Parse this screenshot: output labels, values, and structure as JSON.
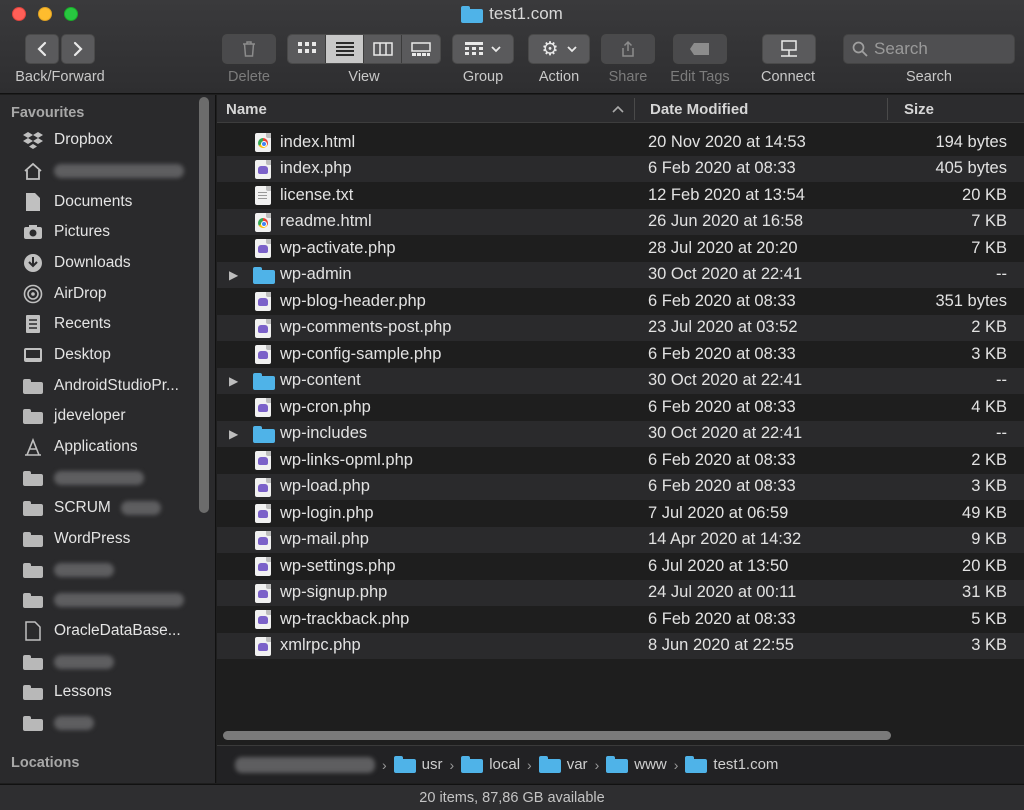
{
  "window": {
    "title": "test1.com"
  },
  "toolbar": {
    "back_forward_label": "Back/Forward",
    "delete_label": "Delete",
    "view_label": "View",
    "group_label": "Group",
    "action_label": "Action",
    "share_label": "Share",
    "edit_tags_label": "Edit Tags",
    "connect_label": "Connect",
    "search_label": "Search",
    "search_placeholder": "Search"
  },
  "sidebar": {
    "favourites_header": "Favourites",
    "locations_header": "Locations",
    "items": [
      {
        "label": "Dropbox",
        "icon": "dropbox-icon"
      },
      {
        "label": "",
        "icon": "home-icon",
        "redacted": true
      },
      {
        "label": "Documents",
        "icon": "document-icon"
      },
      {
        "label": "Pictures",
        "icon": "camera-icon"
      },
      {
        "label": "Downloads",
        "icon": "download-icon"
      },
      {
        "label": "AirDrop",
        "icon": "airdrop-icon"
      },
      {
        "label": "Recents",
        "icon": "recents-icon"
      },
      {
        "label": "Desktop",
        "icon": "desktop-icon"
      },
      {
        "label": "AndroidStudioPr...",
        "icon": "folder-icon"
      },
      {
        "label": "jdeveloper",
        "icon": "folder-icon"
      },
      {
        "label": "Applications",
        "icon": "applications-icon"
      },
      {
        "label": "",
        "icon": "folder-icon",
        "redacted": true
      },
      {
        "label": "SCRUM",
        "icon": "folder-icon"
      },
      {
        "label": "WordPress",
        "icon": "folder-icon"
      },
      {
        "label": "",
        "icon": "folder-icon",
        "redacted": true
      },
      {
        "label": "",
        "icon": "folder-icon",
        "redacted": true
      },
      {
        "label": "OracleDataBase...",
        "icon": "document-icon"
      },
      {
        "label": "",
        "icon": "folder-icon",
        "redacted": true
      },
      {
        "label": "Lessons",
        "icon": "folder-icon"
      },
      {
        "label": "",
        "icon": "folder-icon",
        "redacted": true
      }
    ]
  },
  "columns": {
    "name": "Name",
    "date": "Date Modified",
    "size": "Size"
  },
  "files": [
    {
      "name": "index.html",
      "date": "20 Nov 2020 at 14:53",
      "size": "194 bytes",
      "type": "html"
    },
    {
      "name": "index.php",
      "date": "6 Feb 2020 at 08:33",
      "size": "405 bytes",
      "type": "php"
    },
    {
      "name": "license.txt",
      "date": "12 Feb 2020 at 13:54",
      "size": "20 KB",
      "type": "txt"
    },
    {
      "name": "readme.html",
      "date": "26 Jun 2020 at 16:58",
      "size": "7 KB",
      "type": "html"
    },
    {
      "name": "wp-activate.php",
      "date": "28 Jul 2020 at 20:20",
      "size": "7 KB",
      "type": "php"
    },
    {
      "name": "wp-admin",
      "date": "30 Oct 2020 at 22:41",
      "size": "--",
      "type": "folder"
    },
    {
      "name": "wp-blog-header.php",
      "date": "6 Feb 2020 at 08:33",
      "size": "351 bytes",
      "type": "php"
    },
    {
      "name": "wp-comments-post.php",
      "date": "23 Jul 2020 at 03:52",
      "size": "2 KB",
      "type": "php"
    },
    {
      "name": "wp-config-sample.php",
      "date": "6 Feb 2020 at 08:33",
      "size": "3 KB",
      "type": "php"
    },
    {
      "name": "wp-content",
      "date": "30 Oct 2020 at 22:41",
      "size": "--",
      "type": "folder"
    },
    {
      "name": "wp-cron.php",
      "date": "6 Feb 2020 at 08:33",
      "size": "4 KB",
      "type": "php"
    },
    {
      "name": "wp-includes",
      "date": "30 Oct 2020 at 22:41",
      "size": "--",
      "type": "folder"
    },
    {
      "name": "wp-links-opml.php",
      "date": "6 Feb 2020 at 08:33",
      "size": "2 KB",
      "type": "php"
    },
    {
      "name": "wp-load.php",
      "date": "6 Feb 2020 at 08:33",
      "size": "3 KB",
      "type": "php"
    },
    {
      "name": "wp-login.php",
      "date": "7 Jul 2020 at 06:59",
      "size": "49 KB",
      "type": "php"
    },
    {
      "name": "wp-mail.php",
      "date": "14 Apr 2020 at 14:32",
      "size": "9 KB",
      "type": "php"
    },
    {
      "name": "wp-settings.php",
      "date": "6 Jul 2020 at 13:50",
      "size": "20 KB",
      "type": "php"
    },
    {
      "name": "wp-signup.php",
      "date": "24 Jul 2020 at 00:11",
      "size": "31 KB",
      "type": "php"
    },
    {
      "name": "wp-trackback.php",
      "date": "6 Feb 2020 at 08:33",
      "size": "5 KB",
      "type": "php"
    },
    {
      "name": "xmlrpc.php",
      "date": "8 Jun 2020 at 22:55",
      "size": "3 KB",
      "type": "php"
    }
  ],
  "pathbar": {
    "crumbs": [
      "usr",
      "local",
      "var",
      "www",
      "test1.com"
    ]
  },
  "status": {
    "text": "20 items, 87,86 GB available"
  },
  "colors": {
    "folder": "#4fb3e8",
    "background": "#1e1e1e",
    "sidebar": "#2a2a2c"
  }
}
